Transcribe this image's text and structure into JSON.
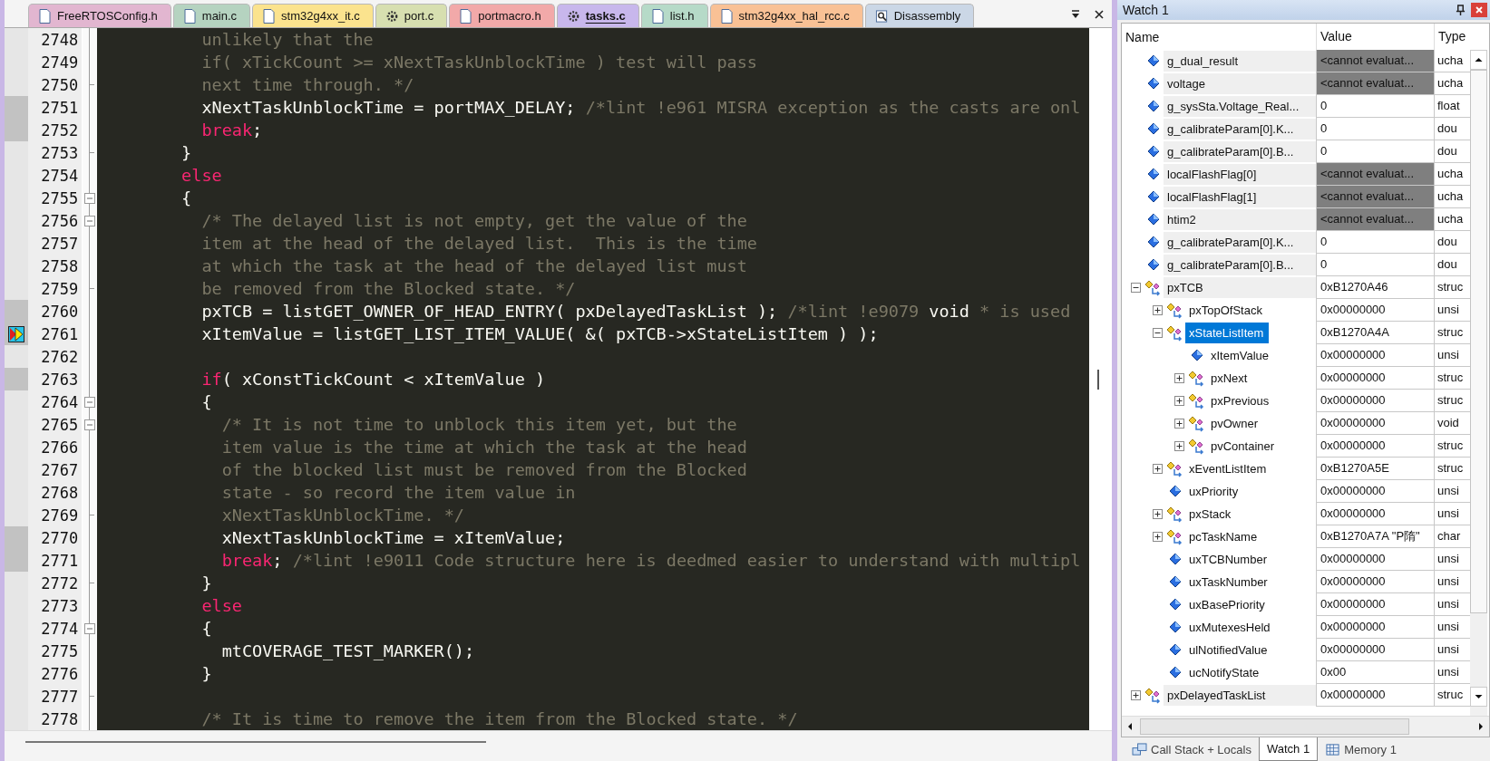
{
  "tabs": [
    {
      "label": "FreeRTOSConfig.h",
      "kind": "file",
      "color": "#e2b6d0",
      "selected": false
    },
    {
      "label": "main.c",
      "kind": "file",
      "color": "#b5d3c0",
      "selected": false
    },
    {
      "label": "stm32g4xx_it.c",
      "kind": "file",
      "color": "#fbe38e",
      "selected": false
    },
    {
      "label": "port.c",
      "kind": "gear",
      "color": "#d7dfb0",
      "selected": false
    },
    {
      "label": "portmacro.h",
      "kind": "file",
      "color": "#f2a9a9",
      "selected": false
    },
    {
      "label": "tasks.c",
      "kind": "gear",
      "color": "#c8b7ec",
      "selected": true
    },
    {
      "label": "list.h",
      "kind": "file",
      "color": "#b6dac8",
      "selected": false
    },
    {
      "label": "stm32g4xx_hal_rcc.c",
      "kind": "file",
      "color": "#f9c195",
      "selected": false
    },
    {
      "label": "Disassembly",
      "kind": "disasm",
      "color": "#cbd7e6",
      "selected": false
    }
  ],
  "editor": {
    "lines": [
      {
        "number": "2748",
        "marked": false,
        "current": false,
        "kind": "line",
        "segments": [
          {
            "kind": "comment",
            "text": "          unlikely that the"
          }
        ]
      },
      {
        "number": "2749",
        "marked": false,
        "current": false,
        "kind": "line",
        "segments": [
          {
            "kind": "comment",
            "text": "          if( xTickCount >= xNextTaskUnblockTime ) test will pass"
          }
        ]
      },
      {
        "number": "2750",
        "marked": false,
        "current": false,
        "kind": "end",
        "segments": [
          {
            "kind": "comment",
            "text": "          next time through. */"
          }
        ]
      },
      {
        "number": "2751",
        "marked": true,
        "current": false,
        "kind": "line",
        "segments": [
          {
            "kind": "plain",
            "text": "          xNextTaskUnblockTime = portMAX_DELAY; "
          },
          {
            "kind": "comment",
            "text": "/*lint !e961 MISRA exception as the casts are onl"
          }
        ]
      },
      {
        "number": "2752",
        "marked": true,
        "current": false,
        "kind": "line",
        "segments": [
          {
            "kind": "keyword",
            "text": "          break"
          },
          {
            "kind": "plain",
            "text": ";"
          }
        ]
      },
      {
        "number": "2753",
        "marked": false,
        "current": false,
        "kind": "end",
        "segments": [
          {
            "kind": "plain",
            "text": "        }"
          }
        ]
      },
      {
        "number": "2754",
        "marked": false,
        "current": false,
        "kind": "line",
        "segments": [
          {
            "kind": "keyword",
            "text": "        else"
          }
        ]
      },
      {
        "number": "2755",
        "marked": false,
        "current": false,
        "kind": "box",
        "segments": [
          {
            "kind": "plain",
            "text": "        {"
          }
        ]
      },
      {
        "number": "2756",
        "marked": false,
        "current": false,
        "kind": "box",
        "segments": [
          {
            "kind": "comment",
            "text": "          /* The delayed list is not empty, get the value of the"
          }
        ]
      },
      {
        "number": "2757",
        "marked": false,
        "current": false,
        "kind": "line",
        "segments": [
          {
            "kind": "comment",
            "text": "          item at the head of the delayed list.  This is the time"
          }
        ]
      },
      {
        "number": "2758",
        "marked": false,
        "current": false,
        "kind": "line",
        "segments": [
          {
            "kind": "comment",
            "text": "          at which the task at the head of the delayed list must"
          }
        ]
      },
      {
        "number": "2759",
        "marked": false,
        "current": false,
        "kind": "end",
        "segments": [
          {
            "kind": "comment",
            "text": "          be removed from the Blocked state. */"
          }
        ]
      },
      {
        "number": "2760",
        "marked": true,
        "current": false,
        "kind": "line",
        "segments": [
          {
            "kind": "plain",
            "text": "          pxTCB = listGET_OWNER_OF_HEAD_ENTRY( pxDelayedTaskList ); "
          },
          {
            "kind": "comment",
            "text": "/*lint !e9079 "
          },
          {
            "kind": "plain",
            "text": "void"
          },
          {
            "kind": "comment",
            "text": " * is used"
          }
        ]
      },
      {
        "number": "2761",
        "marked": true,
        "current": true,
        "kind": "line",
        "segments": [
          {
            "kind": "plain",
            "text": "          xItemValue = listGET_LIST_ITEM_VALUE( &( pxTCB->xStateListItem ) );"
          }
        ]
      },
      {
        "number": "2762",
        "marked": false,
        "current": false,
        "kind": "line"
      },
      {
        "number": "2763",
        "marked": true,
        "current": false,
        "kind": "line",
        "segments": [
          {
            "kind": "keyword",
            "text": "          if"
          },
          {
            "kind": "plain",
            "text": "( xConstTickCount < xItemValue )"
          }
        ]
      },
      {
        "number": "2764",
        "marked": false,
        "current": false,
        "kind": "box",
        "segments": [
          {
            "kind": "plain",
            "text": "          {"
          }
        ]
      },
      {
        "number": "2765",
        "marked": false,
        "current": false,
        "kind": "box",
        "segments": [
          {
            "kind": "comment",
            "text": "            /* It is not time to unblock this item yet, but the"
          }
        ]
      },
      {
        "number": "2766",
        "marked": false,
        "current": false,
        "kind": "line",
        "segments": [
          {
            "kind": "comment",
            "text": "            item value is the time at which the task at the head"
          }
        ]
      },
      {
        "number": "2767",
        "marked": false,
        "current": false,
        "kind": "line",
        "segments": [
          {
            "kind": "comment",
            "text": "            of the blocked list must be removed from the Blocked"
          }
        ]
      },
      {
        "number": "2768",
        "marked": false,
        "current": false,
        "kind": "line",
        "segments": [
          {
            "kind": "comment",
            "text": "            state - so record the item value in"
          }
        ]
      },
      {
        "number": "2769",
        "marked": false,
        "current": false,
        "kind": "end",
        "segments": [
          {
            "kind": "comment",
            "text": "            xNextTaskUnblockTime. */"
          }
        ]
      },
      {
        "number": "2770",
        "marked": true,
        "current": false,
        "kind": "line",
        "segments": [
          {
            "kind": "plain",
            "text": "            xNextTaskUnblockTime = xItemValue;"
          }
        ]
      },
      {
        "number": "2771",
        "marked": true,
        "current": false,
        "kind": "line",
        "segments": [
          {
            "kind": "keyword",
            "text": "            break"
          },
          {
            "kind": "plain",
            "text": "; "
          },
          {
            "kind": "comment",
            "text": "/*lint !e9011 Code structure here is deedmed easier to understand with multipl"
          }
        ]
      },
      {
        "number": "2772",
        "marked": false,
        "current": false,
        "kind": "end",
        "segments": [
          {
            "kind": "plain",
            "text": "          }"
          }
        ]
      },
      {
        "number": "2773",
        "marked": false,
        "current": false,
        "kind": "line",
        "segments": [
          {
            "kind": "keyword",
            "text": "          else"
          }
        ]
      },
      {
        "number": "2774",
        "marked": false,
        "current": false,
        "kind": "box",
        "segments": [
          {
            "kind": "plain",
            "text": "          {"
          }
        ]
      },
      {
        "number": "2775",
        "marked": false,
        "current": false,
        "kind": "line",
        "segments": [
          {
            "kind": "plain",
            "text": "            mtCOVERAGE_TEST_MARKER();"
          }
        ]
      },
      {
        "number": "2776",
        "marked": false,
        "current": false,
        "kind": "line",
        "segments": [
          {
            "kind": "plain",
            "text": "          }"
          }
        ]
      },
      {
        "number": "2777",
        "marked": false,
        "current": false,
        "kind": "end"
      },
      {
        "number": "2778",
        "marked": false,
        "current": false,
        "kind": "line",
        "segments": [
          {
            "kind": "comment",
            "text": "          /* It is time to remove the item from the Blocked state. */"
          }
        ]
      }
    ]
  },
  "watch": {
    "title": "Watch 1",
    "columns": [
      "Name",
      "Value",
      "Type"
    ],
    "rows": [
      {
        "name": "g_dual_result",
        "value": "<cannot evaluat...",
        "type": "ucha",
        "kind": "scalar",
        "unavailable": true,
        "selected": false
      },
      {
        "name": "voltage",
        "value": "<cannot evaluat...",
        "type": "ucha",
        "kind": "scalar",
        "unavailable": true,
        "selected": false
      },
      {
        "name": "g_sysSta.Voltage_Real...",
        "value": "0",
        "type": "float",
        "kind": "scalar",
        "unavailable": false,
        "selected": false
      },
      {
        "name": "g_calibrateParam[0].K...",
        "value": "0",
        "type": "dou",
        "kind": "scalar",
        "unavailable": false,
        "selected": false
      },
      {
        "name": "g_calibrateParam[0].B...",
        "value": "0",
        "type": "dou",
        "kind": "scalar",
        "unavailable": false,
        "selected": false
      },
      {
        "name": "localFlashFlag[0]",
        "value": "<cannot evaluat...",
        "type": "ucha",
        "kind": "scalar",
        "unavailable": true,
        "selected": false
      },
      {
        "name": "localFlashFlag[1]",
        "value": "<cannot evaluat...",
        "type": "ucha",
        "kind": "scalar",
        "unavailable": true,
        "selected": false
      },
      {
        "name": "htim2",
        "value": "<cannot evaluat...",
        "type": "ucha",
        "kind": "scalar",
        "unavailable": true,
        "selected": false
      },
      {
        "name": "g_calibrateParam[0].K...",
        "value": "0",
        "type": "dou",
        "kind": "scalar",
        "unavailable": false,
        "selected": false
      },
      {
        "name": "g_calibrateParam[0].B...",
        "value": "0",
        "type": "dou",
        "kind": "scalar",
        "unavailable": false,
        "selected": false
      },
      {
        "name": "pxTCB",
        "value": "0xB1270A46",
        "type": "struc",
        "kind": "struct",
        "expanded": true,
        "unavailable": false,
        "selected": false,
        "children": [
          {
            "name": "pxTopOfStack",
            "value": "0x00000000",
            "type": "unsi",
            "kind": "struct",
            "expanded": false,
            "unavailable": false,
            "selected": false
          },
          {
            "name": "xStateListItem",
            "value": "0xB1270A4A",
            "type": "struc",
            "kind": "struct",
            "expanded": true,
            "unavailable": false,
            "selected": true,
            "children": [
              {
                "name": "xItemValue",
                "value": "0x00000000",
                "type": "unsi",
                "kind": "scalar",
                "unavailable": false,
                "selected": false
              },
              {
                "name": "pxNext",
                "value": "0x00000000",
                "type": "struc",
                "kind": "struct",
                "expanded": false,
                "unavailable": false,
                "selected": false
              },
              {
                "name": "pxPrevious",
                "value": "0x00000000",
                "type": "struc",
                "kind": "struct",
                "expanded": false,
                "unavailable": false,
                "selected": false
              },
              {
                "name": "pvOwner",
                "value": "0x00000000",
                "type": "void",
                "kind": "struct",
                "expanded": false,
                "unavailable": false,
                "selected": false
              },
              {
                "name": "pvContainer",
                "value": "0x00000000",
                "type": "struc",
                "kind": "struct",
                "expanded": false,
                "unavailable": false,
                "selected": false
              }
            ]
          },
          {
            "name": "xEventListItem",
            "value": "0xB1270A5E",
            "type": "struc",
            "kind": "struct",
            "expanded": false,
            "unavailable": false,
            "selected": false
          },
          {
            "name": "uxPriority",
            "value": "0x00000000",
            "type": "unsi",
            "kind": "scalar",
            "unavailable": false,
            "selected": false
          },
          {
            "name": "pxStack",
            "value": "0x00000000",
            "type": "unsi",
            "kind": "struct",
            "expanded": false,
            "unavailable": false,
            "selected": false
          },
          {
            "name": "pcTaskName",
            "value": "0xB1270A7A \"P隋\"",
            "type": "char",
            "kind": "struct",
            "expanded": false,
            "unavailable": false,
            "selected": false
          },
          {
            "name": "uxTCBNumber",
            "value": "0x00000000",
            "type": "unsi",
            "kind": "scalar",
            "unavailable": false,
            "selected": false
          },
          {
            "name": "uxTaskNumber",
            "value": "0x00000000",
            "type": "unsi",
            "kind": "scalar",
            "unavailable": false,
            "selected": false
          },
          {
            "name": "uxBasePriority",
            "value": "0x00000000",
            "type": "unsi",
            "kind": "scalar",
            "unavailable": false,
            "selected": false
          },
          {
            "name": "uxMutexesHeld",
            "value": "0x00000000",
            "type": "unsi",
            "kind": "scalar",
            "unavailable": false,
            "selected": false
          },
          {
            "name": "ulNotifiedValue",
            "value": "0x00000000",
            "type": "unsi",
            "kind": "scalar",
            "unavailable": false,
            "selected": false
          },
          {
            "name": "ucNotifyState",
            "value": "0x00",
            "type": "unsi",
            "kind": "scalar",
            "unavailable": false,
            "selected": false
          }
        ]
      },
      {
        "name": "pxDelayedTaskList",
        "value": "0x00000000",
        "type": "struc",
        "kind": "struct",
        "expanded": false,
        "unavailable": false,
        "selected": false
      }
    ]
  },
  "bottom_tabs": [
    {
      "label": "Call Stack + Locals",
      "kind": "stack",
      "selected": false
    },
    {
      "label": "Watch 1",
      "kind": "plain",
      "selected": true
    },
    {
      "label": "Memory 1",
      "kind": "memory",
      "selected": false
    }
  ]
}
